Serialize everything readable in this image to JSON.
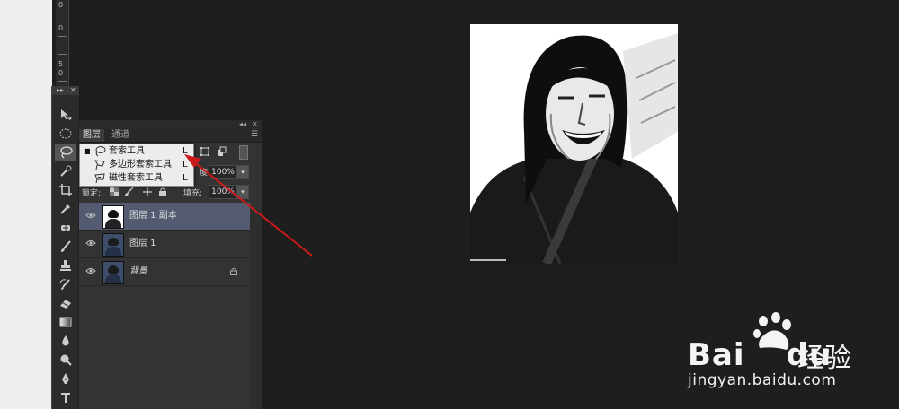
{
  "ruler": {
    "numbers": [
      "0",
      "0",
      "5",
      "0"
    ]
  },
  "toolbar": {
    "tools": [
      "move-tool",
      "marquee-tool",
      "lasso-tool",
      "quick-selection-tool",
      "crop-tool",
      "eyedropper-tool",
      "spot-healing-tool",
      "brush-tool",
      "clone-stamp-tool",
      "history-brush-tool",
      "eraser-tool",
      "gradient-tool",
      "blur-tool",
      "dodge-tool",
      "pen-tool",
      "type-tool"
    ]
  },
  "layers_panel": {
    "tabs": [
      {
        "label": "图层"
      },
      {
        "label": "通道"
      }
    ],
    "opacity_value": "100%",
    "lock_label": "锁定:",
    "fill_label": "填充:",
    "fill_value": "100%",
    "layers": [
      {
        "name": "图层 1 副本",
        "selected": true
      },
      {
        "name": "图层 1",
        "selected": false
      },
      {
        "name": "背景",
        "selected": false,
        "locked": true
      }
    ]
  },
  "flyout": {
    "items": [
      {
        "label": "套索工具",
        "shortcut": "L",
        "current": true
      },
      {
        "label": "多边形套索工具",
        "shortcut": "L",
        "current": false
      },
      {
        "label": "磁性套索工具",
        "shortcut": "L",
        "current": false
      }
    ]
  },
  "watermark": {
    "brand": "Bai",
    "brand_suffix": "du",
    "brand_cn": "经验",
    "url": "jingyan.baidu.com"
  },
  "colors": {
    "accent_arrow": "#cc1a1a",
    "selected_layer": "#545b70"
  }
}
